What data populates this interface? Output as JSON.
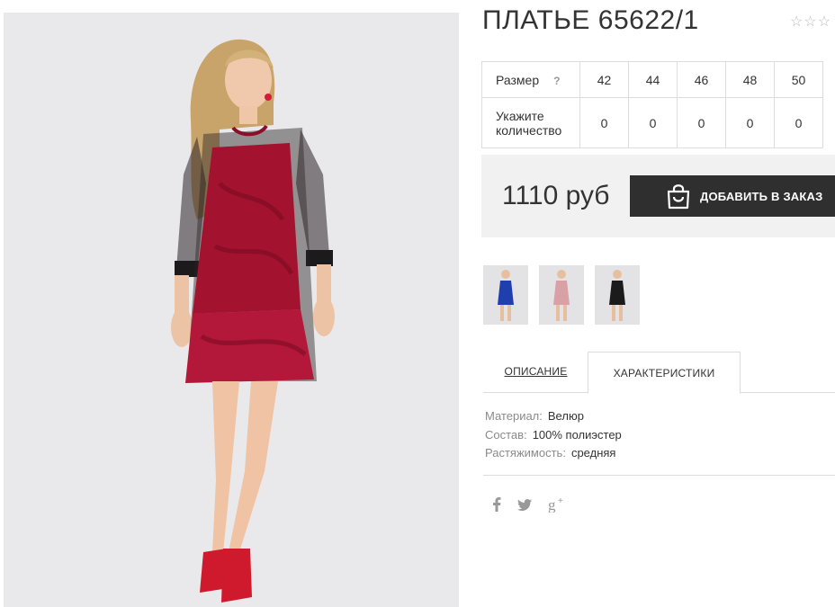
{
  "product": {
    "title": "ПЛАТЬЕ 65622/1",
    "rating_stars": "☆☆☆",
    "photo_icon": "dress-photo"
  },
  "size_table": {
    "size_label": "Размер",
    "help_mark": "?",
    "quantity_label": "Укажите количество",
    "sizes": [
      "42",
      "44",
      "46",
      "48",
      "50"
    ],
    "quantities": [
      "0",
      "0",
      "0",
      "0",
      "0"
    ]
  },
  "purchase": {
    "price": "1110 руб",
    "add_button_label": "ДОБАВИТЬ В ЗАКАЗ",
    "add_button_icon": "shopping-bag-icon"
  },
  "thumbnails": [
    {
      "color_name": "blue",
      "color": "#1f3fae"
    },
    {
      "color_name": "pink",
      "color": "#d9a0a6"
    },
    {
      "color_name": "black",
      "color": "#1b1b1b"
    }
  ],
  "tabs": {
    "description": "ОПИСАНИЕ",
    "characteristics": "ХАРАКТЕРИСТИКИ",
    "active": "characteristics"
  },
  "characteristics": [
    {
      "label": "Материал:",
      "value": "Велюр"
    },
    {
      "label": "Состав:",
      "value": "100% полиэстер"
    },
    {
      "label": "Растяжимость:",
      "value": "средняя"
    }
  ],
  "social": [
    "facebook-icon",
    "twitter-icon",
    "google-plus-icon"
  ],
  "colors": {
    "dress": "#a3122f",
    "button_bg": "#2f2f2f",
    "price_bg": "#f1f1f1",
    "photo_bg": "#e9e9eb"
  }
}
